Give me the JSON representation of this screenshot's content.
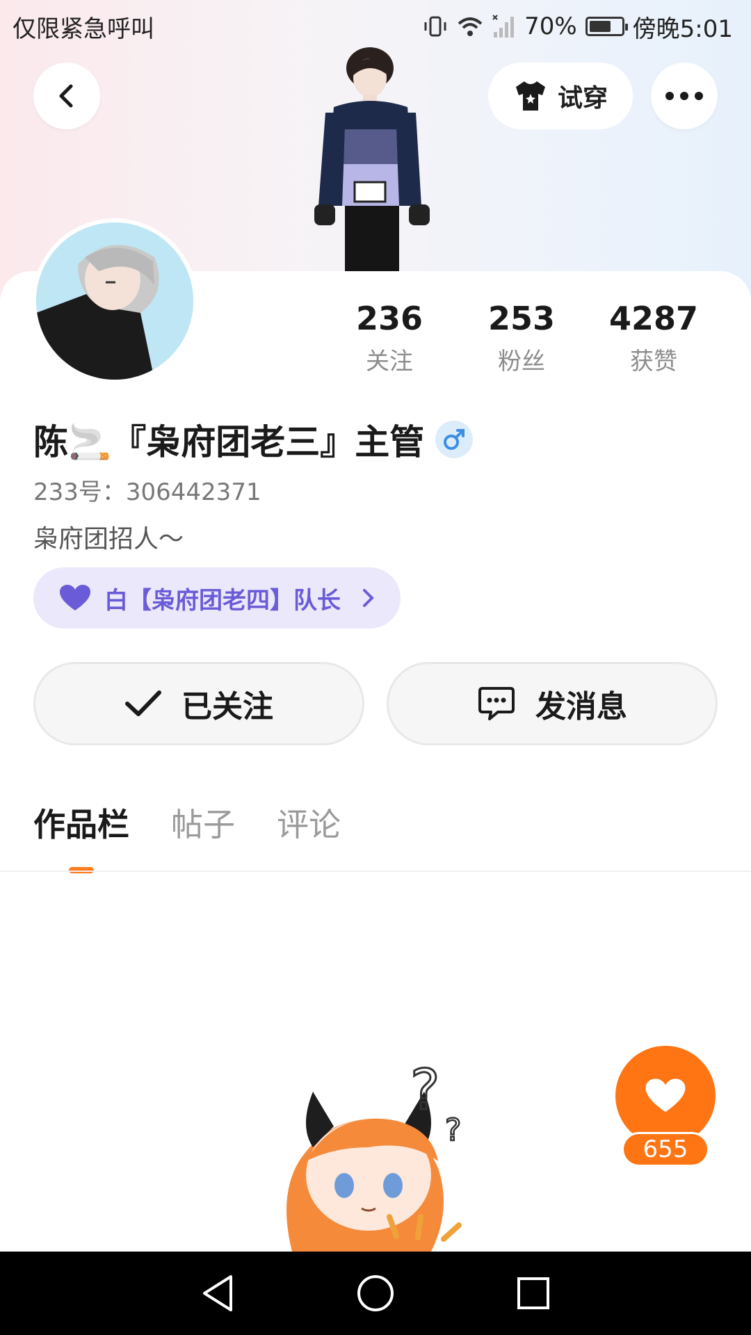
{
  "status_bar": {
    "left_text": "仅限紧急呼叫",
    "battery_percent": "70%",
    "battery_level": 0.7,
    "time": "傍晚5:01"
  },
  "header": {
    "back_icon": "chevron-left-icon",
    "tryon_label": "试穿",
    "more_icon": "more-horizontal-icon"
  },
  "profile": {
    "name": "陈🚬『枭府团老三』主管",
    "gender_symbol": "♂",
    "uid_text": "233号：306442371",
    "bio": "枭府团招人～",
    "team_label": "白【枭府团老四】队长"
  },
  "stats": [
    {
      "value": "236",
      "label": "关注"
    },
    {
      "value": "253",
      "label": "粉丝"
    },
    {
      "value": "4287",
      "label": "获赞"
    }
  ],
  "actions": {
    "follow_label": "已关注",
    "message_label": "发消息"
  },
  "tabs": [
    {
      "label": "作品栏",
      "active": true
    },
    {
      "label": "帖子",
      "active": false
    },
    {
      "label": "评论",
      "active": false
    }
  ],
  "like": {
    "count": "655"
  },
  "colors": {
    "accent_orange": "#ff7413",
    "team_purple": "#6a5bd8",
    "team_bg": "#ebe8fb",
    "gender_blue": "#3a8ee6"
  }
}
